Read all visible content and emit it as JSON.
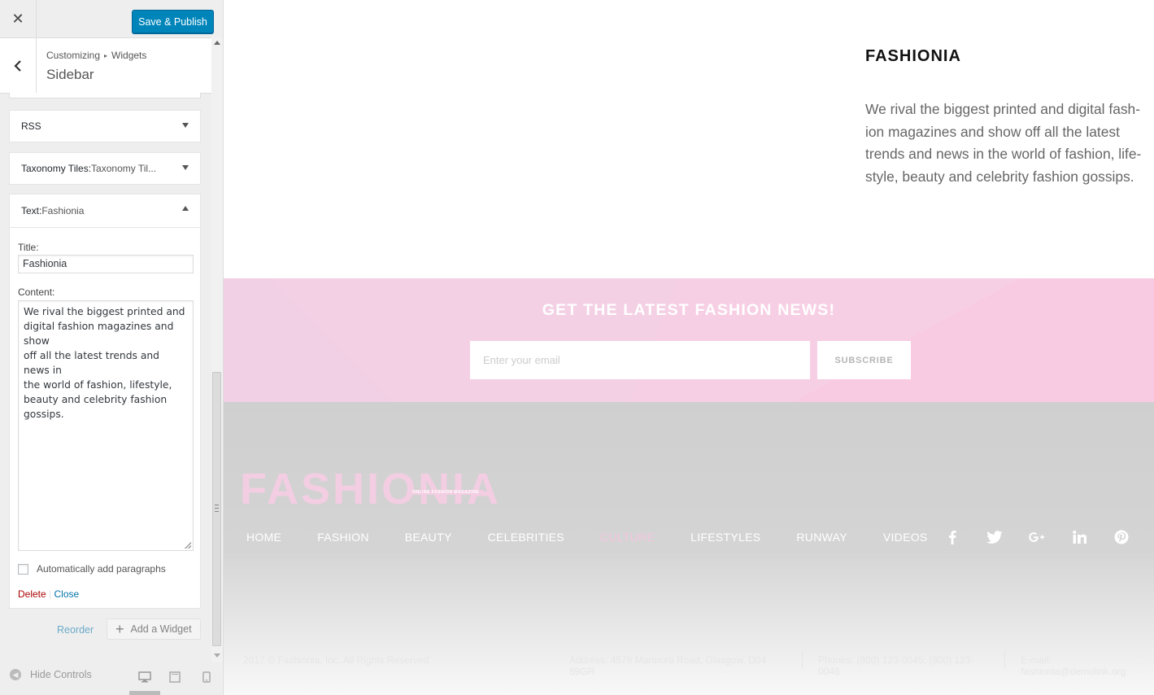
{
  "customizer": {
    "close_label": "✕",
    "publish_label": "Save & Publish",
    "breadcrumb": {
      "root": "Customizing",
      "separator": "▸",
      "current": "Widgets"
    },
    "section_title": "Sidebar",
    "widgets": [
      {
        "type": "RSS",
        "instance": ""
      },
      {
        "type": "Taxonomy Tiles:",
        "instance": " Taxonomy Til..."
      },
      {
        "type": "Text:",
        "instance": " Fashionia"
      }
    ],
    "text_widget": {
      "title_label": "Title:",
      "title_value": "Fashionia",
      "content_label": "Content:",
      "content_value": "We rival the biggest printed and\ndigital fashion magazines and show\noff all the latest trends and news in\nthe world of fashion, lifestyle,\nbeauty and celebrity fashion\ngossips.",
      "autop_label": "Automatically add paragraphs",
      "autop_checked": false,
      "delete_label": "Delete",
      "action_separator": " | ",
      "close_label": "Close"
    },
    "reorder_label": "Reorder",
    "add_widget_label": "Add a Widget",
    "hide_controls_label": "Hide Controls",
    "devices": [
      "desktop-icon",
      "tablet-icon",
      "mobile-icon"
    ],
    "accent_color": "#0085ba"
  },
  "preview": {
    "widget_title": "FASHIONIA",
    "widget_text": "We rival the biggest printed and digital fash-ion magazines and show off all the latest trends and news in the world of fashion, life-style, beauty and celebrity fashion gossips.",
    "newsletter": {
      "title": "GET THE LATEST FASHION NEWS!",
      "email_placeholder": "Enter your email",
      "button_label": "SUBSCRIBE",
      "background": "#f6cde4"
    },
    "footer": {
      "logo": "FASHIONIA",
      "logo_tagline": "ONLINE FASHION MAGAZINE",
      "nav": [
        "HOME",
        "FASHION",
        "BEAUTY",
        "CELEBRITIES",
        "CULTURE",
        "LIFESTYLES",
        "RUNWAY",
        "VIDEOS"
      ],
      "nav_active": "CULTURE",
      "social": [
        "facebook-icon",
        "twitter-icon",
        "google-plus-icon",
        "linkedin-icon",
        "pinterest-icon"
      ],
      "copyright": "2017 © Fashionia, Inc. All Rights Reserved",
      "address": "Address: 4578 Marmora Road, Glasgow, D04 89GR",
      "phones": "Phones: (800) 123-0045; (800) 123-0046",
      "email": "E-mail: fashionia@demolink.org"
    }
  }
}
